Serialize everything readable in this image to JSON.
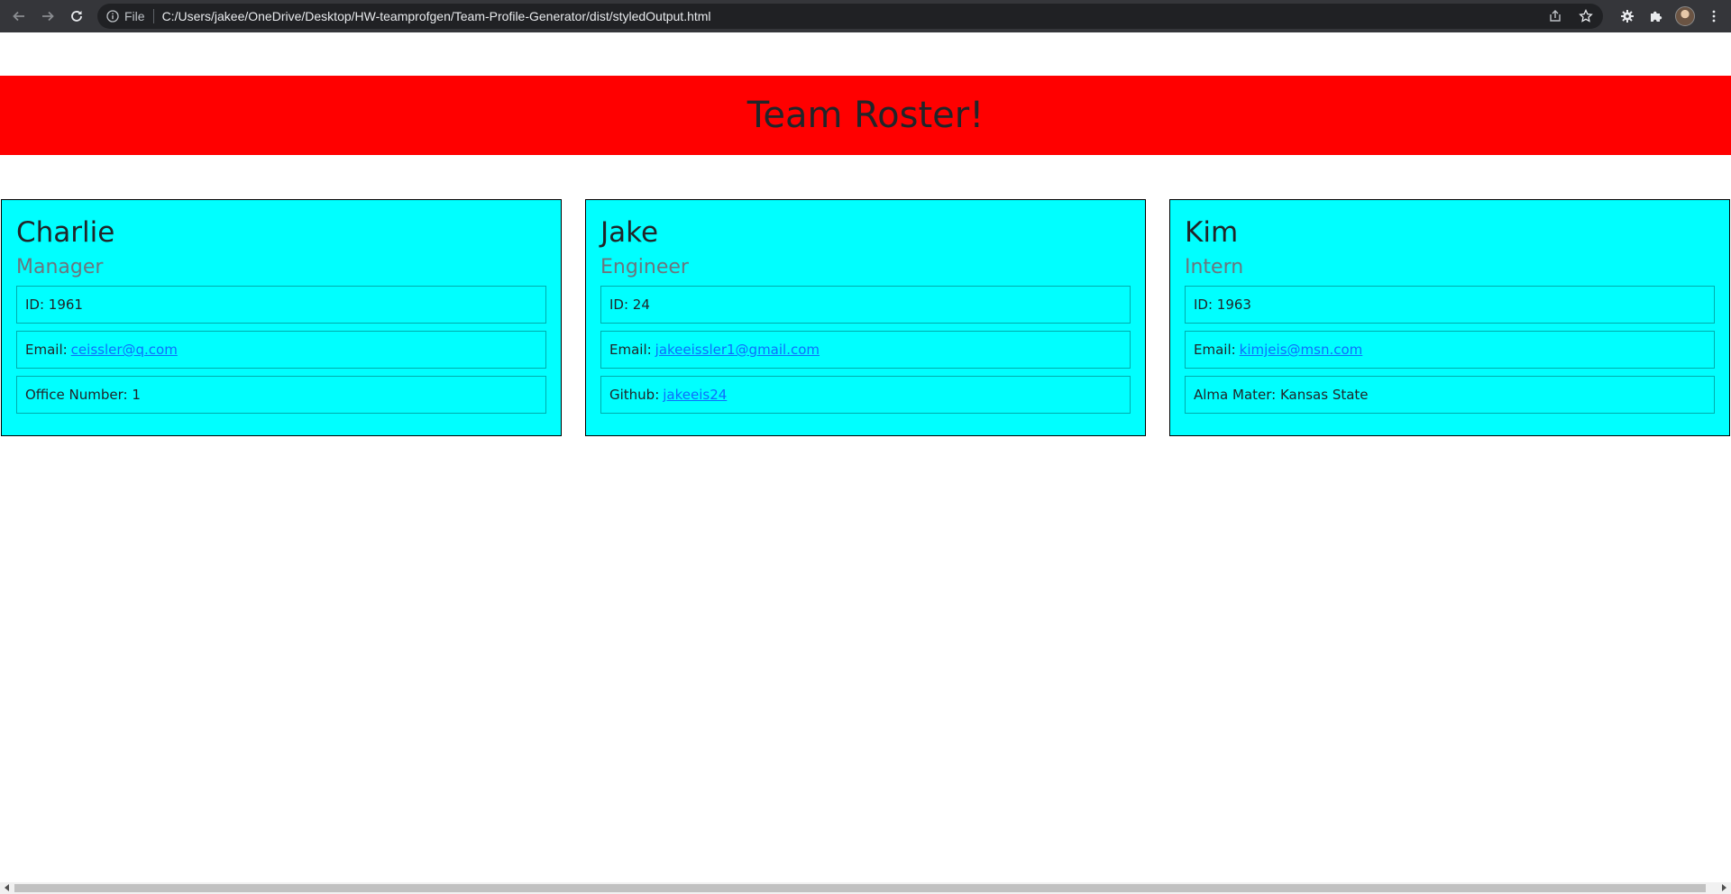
{
  "browser": {
    "url_scheme_label": "File",
    "url": "C:/Users/jakee/OneDrive/Desktop/HW-teamprofgen/Team-Profile-Generator/dist/styledOutput.html",
    "icons": [
      "back-arrow-icon",
      "forward-arrow-icon",
      "reload-icon",
      "info-icon",
      "share-icon",
      "star-icon",
      "extension-gear-icon",
      "puzzle-icon",
      "avatar",
      "kebab-menu-icon"
    ]
  },
  "page": {
    "title": "Team Roster!",
    "banner_color": "#ff0000",
    "card_color": "#00ffff"
  },
  "team": [
    {
      "name": "Charlie",
      "role": "Manager",
      "id_label": "ID: 1961",
      "email_prefix": "Email:",
      "email": "ceissler@q.com",
      "extra_prefix": "Office Number: 1",
      "extra_link": ""
    },
    {
      "name": "Jake",
      "role": "Engineer",
      "id_label": "ID: 24",
      "email_prefix": "Email:",
      "email": "jakeeissler1@gmail.com",
      "extra_prefix": "Github:",
      "extra_link": "jakeeis24"
    },
    {
      "name": "Kim",
      "role": "Intern",
      "id_label": "ID: 1963",
      "email_prefix": "Email:",
      "email": "kimjeis@msn.com",
      "extra_prefix": "Alma Mater: Kansas State",
      "extra_link": ""
    }
  ]
}
